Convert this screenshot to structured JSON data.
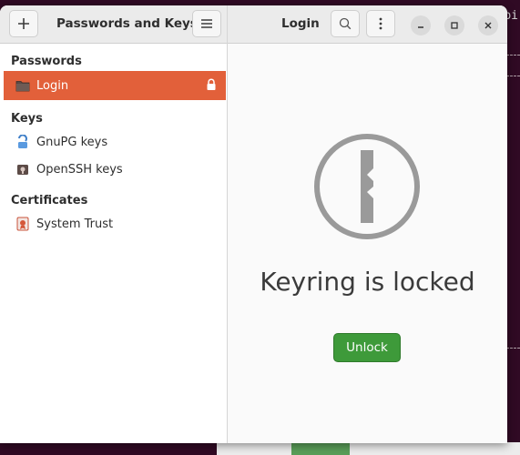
{
  "window": {
    "sidebar_title": "Passwords and Keys",
    "main_title": "Login"
  },
  "sidebar": {
    "sections": [
      {
        "label": "Passwords",
        "items": [
          {
            "label": "Login",
            "icon": "folder-icon",
            "selected": true,
            "locked": true
          }
        ]
      },
      {
        "label": "Keys",
        "items": [
          {
            "label": "GnuPG keys",
            "icon": "gnupg-key-icon"
          },
          {
            "label": "OpenSSH keys",
            "icon": "ssh-key-icon"
          }
        ]
      },
      {
        "label": "Certificates",
        "items": [
          {
            "label": "System Trust",
            "icon": "certificate-icon"
          }
        ]
      }
    ]
  },
  "main": {
    "message": "Keyring is locked",
    "unlock_label": "Unlock"
  },
  "background": {
    "terminal_text": "bi"
  },
  "colors": {
    "accent": "#e2603a",
    "unlock": "#3e9a3a",
    "header": "#ebebeb"
  }
}
